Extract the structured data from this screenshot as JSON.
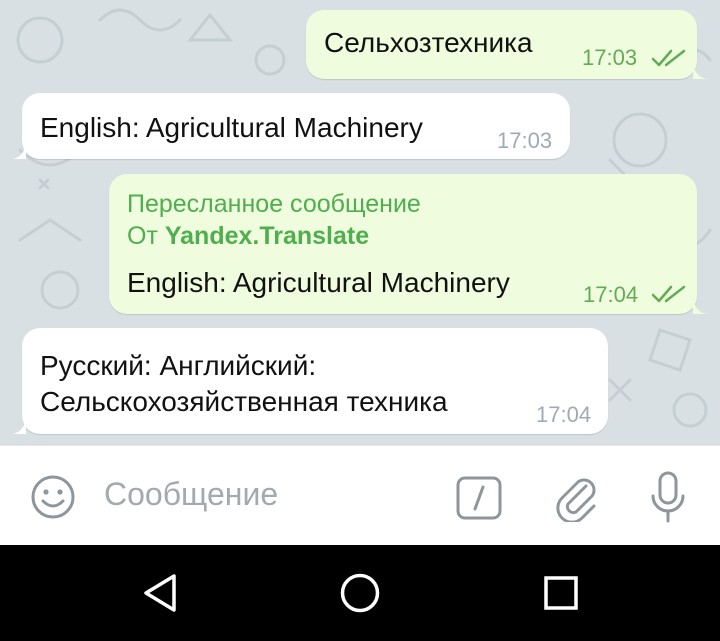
{
  "messages": [
    {
      "direction": "outgoing",
      "text": "Сельхозтехника",
      "time": "17:03",
      "status": "read"
    },
    {
      "direction": "incoming",
      "text": "English: Agricultural Machinery",
      "time": "17:03"
    },
    {
      "direction": "outgoing",
      "forwarded_header": "Пересланное сообщение",
      "forwarded_from_prefix": "От",
      "forwarded_from": "Yandex.Translate",
      "text": "English: Agricultural Machinery",
      "time": "17:04",
      "status": "read"
    },
    {
      "direction": "incoming",
      "lines": [
        "Русский: Английский:",
        "Сельскохозяйственная техника"
      ],
      "time": "17:04"
    }
  ],
  "composer": {
    "placeholder": "Сообщение"
  },
  "icons": {
    "emoji": "emoji-icon",
    "command": "bot-command-icon",
    "attach": "paperclip-icon",
    "mic": "microphone-icon",
    "back": "back-triangle-icon",
    "home": "home-circle-icon",
    "recents": "recents-square-icon"
  },
  "colors": {
    "chat_background": "#d8e0e3",
    "outgoing_bubble": "#effdde",
    "incoming_bubble": "#ffffff",
    "accent_green": "#4fae4e",
    "icon_grey": "#8e969b"
  }
}
